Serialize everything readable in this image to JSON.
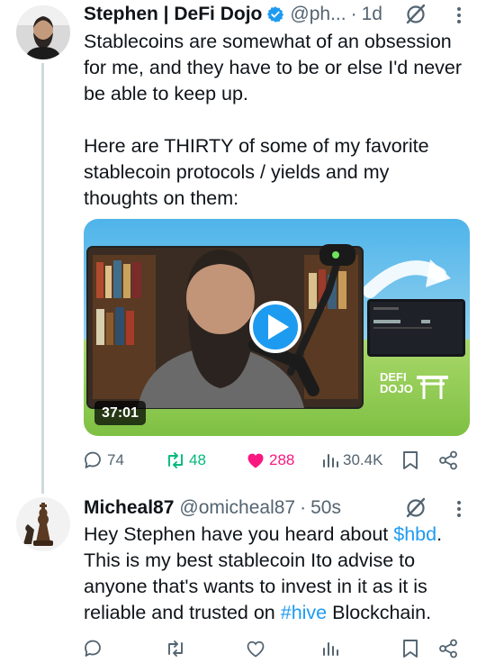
{
  "tweet1": {
    "author_name": "Stephen | DeFi Dojo",
    "handle": "@ph...",
    "separator": "·",
    "time": "1d",
    "text": "Stablecoins are somewhat of an obsession for me, and they have to be or else I'd never be able to keep up.\n\nHere are THIRTY of some of my favorite stablecoin protocols / yields and my thoughts on them:",
    "video": {
      "duration": "37:01",
      "logo_line1": "DEFI",
      "logo_line2": "DOJO"
    },
    "metrics": {
      "replies": "74",
      "reposts": "48",
      "likes": "288",
      "views": "30.4K"
    },
    "colors": {
      "repost": "#00ba7c",
      "like": "#f91880",
      "verified": "#1d9bf0"
    }
  },
  "tweet2": {
    "author_name": "Micheal87",
    "handle": "@omicheal87",
    "separator": "·",
    "time": "50s",
    "text_part1": "Hey Stephen have you heard about ",
    "link1": "$hbd",
    "text_part2": ".\nThis is my best stablecoin Ito advise to anyone that's wants to invest in it as it is reliable and trusted on ",
    "link2": "#hive",
    "text_part3": " Blockchain."
  }
}
